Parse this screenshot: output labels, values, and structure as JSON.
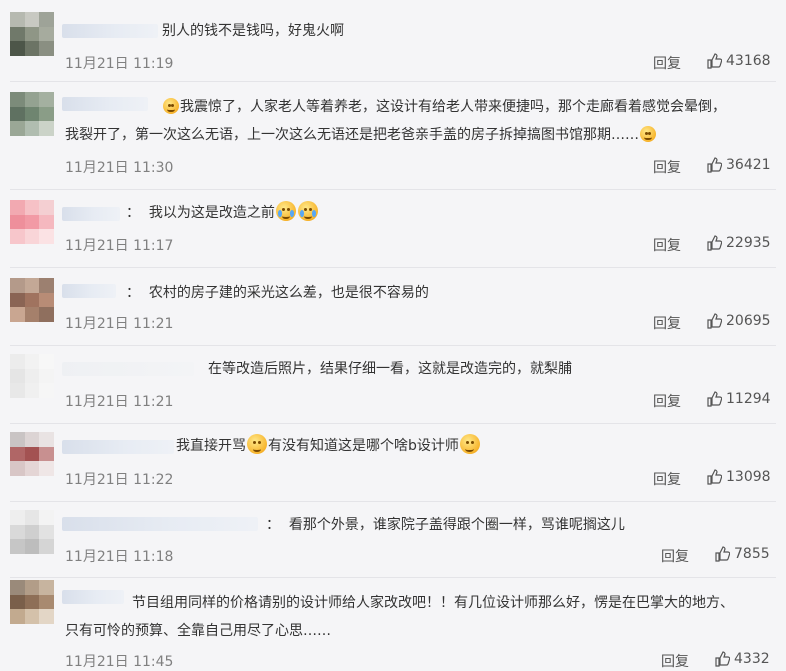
{
  "actions": {
    "reply_label": "回复"
  },
  "colors": {
    "background": "#f5f5f7",
    "time": "#808080",
    "text": "#333333"
  },
  "comments": [
    {
      "text": "别人的钱不是钱吗，好鬼火啊",
      "time": "11月21日 11:19",
      "likes": "43168",
      "avatar": [
        "#b6b9b0",
        "#c8c9c2",
        "#9ea398",
        "#70796a",
        "#8f9686",
        "#a6ab9e",
        "#4d5649",
        "#6c7465",
        "#8a8f82"
      ]
    },
    {
      "text_line1": "我震惊了，人家老人等着养老，这设计有给老人带来便捷吗，那个走廊看着感觉会晕倒，",
      "text_line2": "我裂开了，第一次这么无语，上一次这么无语还是把老爸亲手盖的房子拆掉搞图书馆那期……",
      "time": "11月21日 11:30",
      "likes": "36421",
      "avatar": [
        "#7c8b7a",
        "#94a291",
        "#a4b0a0",
        "#5f7161",
        "#6f8570",
        "#8a9d87",
        "#9aa796",
        "#b0bdb0",
        "#cbd3c8"
      ]
    },
    {
      "prefix": "：",
      "text": "我以为这是改造之前",
      "time": "11月21日 11:17",
      "likes": "22935",
      "avatar": [
        "#f2a9b1",
        "#f6c1c6",
        "#f4cfd2",
        "#ee8f9b",
        "#f29aa5",
        "#f5b8bf",
        "#f7c6cb",
        "#f9d5d8",
        "#fbe2e4"
      ]
    },
    {
      "prefix": "：",
      "text": "农村的房子建的采光这么差，也是很不容易的",
      "time": "11月21日 11:21",
      "likes": "20695",
      "avatar": [
        "#b49a8a",
        "#c3a896",
        "#9c8070",
        "#8a6454",
        "#a0735f",
        "#b88c76",
        "#c9a691",
        "#a5806b",
        "#8f6f5e"
      ]
    },
    {
      "text": "在等改造后照片，结果仔细一看，这就是改造完的，就梨脯",
      "time": "11月21日 11:21",
      "likes": "11294",
      "avatar": [
        "#ececec",
        "#f2f2f2",
        "#f7f7f7",
        "#e5e5e5",
        "#eeeeee",
        "#f4f4f4",
        "#e8e8e8",
        "#f0f0f0",
        "#f6f6f6"
      ]
    },
    {
      "text1": "我直接开骂",
      "text2": "有没有知道这是哪个啥b设计师",
      "time": "11月21日 11:22",
      "likes": "13098",
      "avatar": [
        "#c9c4c4",
        "#dcd4d4",
        "#e9e3e3",
        "#b06666",
        "#a35252",
        "#c89090",
        "#d8c6c6",
        "#e4d5d5",
        "#efe6e6"
      ]
    },
    {
      "prefix": "：",
      "text": "看那个外景，谁家院子盖得跟个圈一样，骂谁呢搁这儿",
      "time": "11月21日 11:18",
      "likes": "7855",
      "avatar": [
        "#eeeeee",
        "#e6e6e6",
        "#f3f3f3",
        "#d9d9d9",
        "#cfcfcf",
        "#e2e2e2",
        "#c6c6c6",
        "#bdbdbd",
        "#d5d5d5"
      ]
    },
    {
      "text_line1": "节目组用同样的价格请别的设计师给人家改改吧！！有几位设计师那么好，愣是在巴掌大的地方、",
      "text_line2": "只有可怜的预算、全靠自己用尽了心思……",
      "time": "11月21日 11:45",
      "likes": "4332",
      "avatar": [
        "#9a8a7a",
        "#b29d88",
        "#c7b49f",
        "#7a5f4a",
        "#8e6f57",
        "#a88a70",
        "#c2aa8f",
        "#d4c1aa",
        "#e3d6c6"
      ]
    }
  ]
}
